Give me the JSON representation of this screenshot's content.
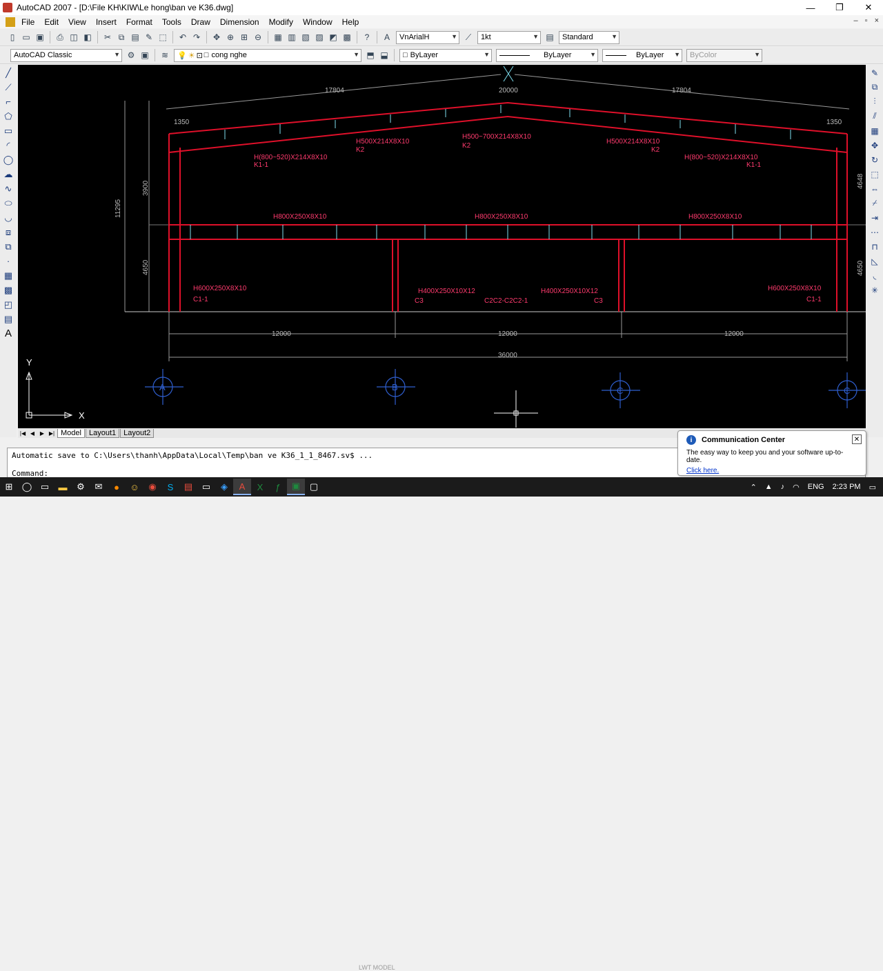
{
  "window": {
    "title": "AutoCAD 2007 - [D:\\File KH\\KIW\\Le hong\\ban ve K36.dwg]",
    "minimize": "—",
    "restore": "❐",
    "close": "✕"
  },
  "menu": [
    "File",
    "Edit",
    "View",
    "Insert",
    "Format",
    "Tools",
    "Draw",
    "Dimension",
    "Modify",
    "Window",
    "Help"
  ],
  "doc_controls": {
    "min": "–",
    "restore": "▫",
    "close": "×"
  },
  "toolbar1": {
    "text_style": "VnArialH",
    "dim_style": "1kt",
    "table_style": "Standard"
  },
  "toolbar2": {
    "workspace": "AutoCAD Classic",
    "layer": "cong nghe",
    "color": "ByLayer",
    "linetype": "ByLayer",
    "lineweight": "ByLayer",
    "plotstyle": "ByColor"
  },
  "drawing": {
    "dims_top": [
      "17804",
      "20000",
      "17804"
    ],
    "dim_1350_left": "1350",
    "dim_1350_right": "1350",
    "dim_left_3900": "3900",
    "dim_left_11295": "11295",
    "dim_left_4650": "4650",
    "dim_right_4648": "4648",
    "dim_right_4650": "4650",
    "rafter_labels": [
      {
        "text": "H(800~520)X214X8X10",
        "sub": "K1-1"
      },
      {
        "text": "H500X214X8X10",
        "sub": "K2"
      },
      {
        "text": "H500~700X214X8X10",
        "sub": "K2"
      },
      {
        "text": "H500X214X8X10",
        "sub": "K2"
      },
      {
        "text": "H(800~520)X214X8X10",
        "sub": "K1-1"
      }
    ],
    "beam_labels": [
      "H800X250X8X10",
      "H800X250X8X10",
      "H800X250X8X10"
    ],
    "column_labels": [
      {
        "text": "H600X250X8X10",
        "sub": "C1-1"
      },
      {
        "text": "H400X250X10X12",
        "sub": "C3"
      },
      {
        "text": "H400X250X10X12",
        "sub": "C3"
      },
      {
        "text": "H600X250X8X10",
        "sub": "C1-1"
      }
    ],
    "section_label": "C2C2-C2C2-1",
    "spans": [
      "12000",
      "12000",
      "12000"
    ],
    "total": "36000",
    "grid_marks": [
      "A",
      "B",
      "C",
      "C"
    ],
    "ucs_x": "X",
    "ucs_y": "Y"
  },
  "tabs": [
    "Model",
    "Layout1",
    "Layout2"
  ],
  "command": {
    "line1": "Automatic save to C:\\Users\\thanh\\AppData\\Local\\Temp\\ban ve K36_1_1_8467.sv$ ...",
    "line2": "Command:"
  },
  "notification": {
    "title": "Communication Center",
    "body": "The easy way to keep you and your software up-to-date.",
    "link": "Click here."
  },
  "taskbar": {
    "lang": "ENG",
    "time": "2:23 PM",
    "status_hint": "LWT  MODEL"
  }
}
